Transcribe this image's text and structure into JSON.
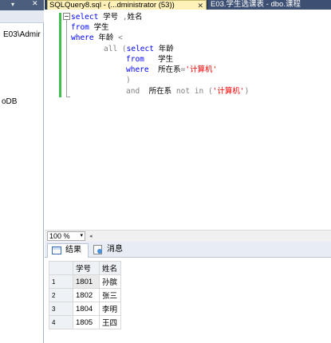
{
  "object_explorer": {
    "header_pin": "▾",
    "header_close": "✕",
    "server_label": "E03\\Admir",
    "db_label": "oDB"
  },
  "tabs": [
    {
      "label": "SQLQuery8.sql - (...dministrator (53))",
      "close": "✕",
      "active": true
    },
    {
      "label": "E03.学生选课表 - dbo.课程",
      "active": false
    }
  ],
  "editor": {
    "collapse_glyph": "−",
    "lines": [
      [
        "select 学号 ,姓名"
      ],
      [
        "from 学生"
      ],
      [
        "where 年龄 <"
      ],
      [
        "all (select 年龄"
      ],
      [
        "from   学生"
      ],
      [
        "where  所在系='计算机'"
      ],
      [
        ")"
      ],
      [
        "and  所在系 not in ('计算机')"
      ]
    ]
  },
  "zoom": {
    "value": "100 %",
    "arrow": "▾"
  },
  "results_tabs": [
    {
      "label": "结果",
      "active": true
    },
    {
      "label": "消息",
      "active": false
    }
  ],
  "grid": {
    "columns": [
      "学号",
      "姓名"
    ],
    "rows": [
      {
        "n": "1",
        "id": "1801",
        "name": "孙膑"
      },
      {
        "n": "2",
        "id": "1802",
        "name": "张三"
      },
      {
        "n": "3",
        "id": "1804",
        "name": "李明"
      },
      {
        "n": "4",
        "id": "1805",
        "name": "王四"
      }
    ]
  }
}
